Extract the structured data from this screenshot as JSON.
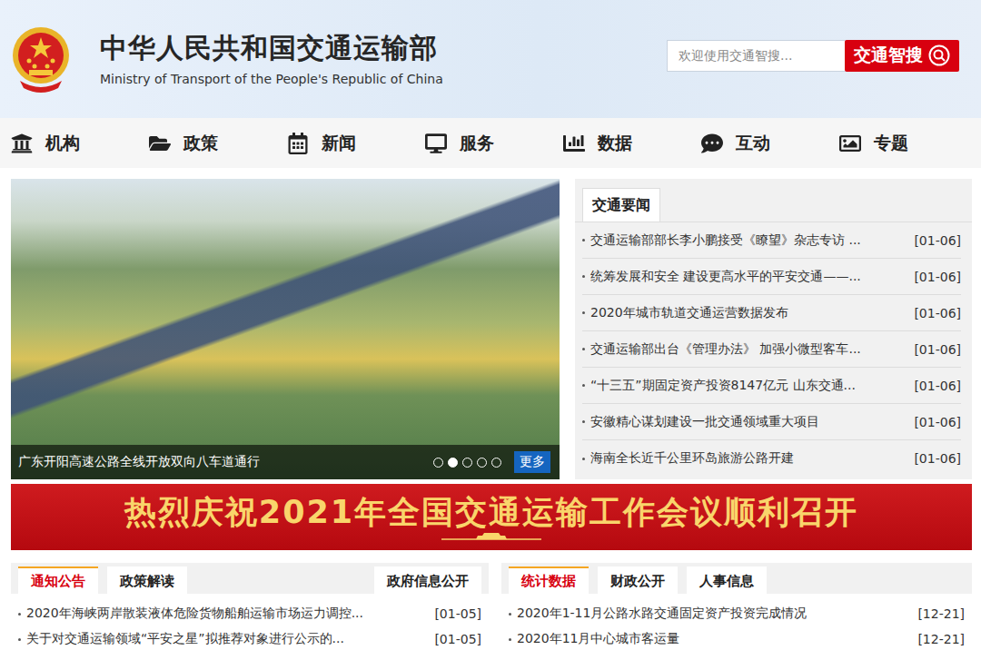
{
  "header": {
    "title": "中华人民共和国交通运输部",
    "subtitle": "Ministry of Transport of the People's Republic of China",
    "search": {
      "placeholder": "欢迎使用交通智搜...",
      "button": "交通智搜"
    }
  },
  "nav": [
    {
      "label": "机构"
    },
    {
      "label": "政策"
    },
    {
      "label": "新闻"
    },
    {
      "label": "服务"
    },
    {
      "label": "数据"
    },
    {
      "label": "互动"
    },
    {
      "label": "专题"
    }
  ],
  "carousel": {
    "caption": "广东开阳高速公路全线开放双向八车道通行",
    "slides": [
      {
        "selected": false
      },
      {
        "selected": true
      },
      {
        "selected": false
      },
      {
        "selected": false
      },
      {
        "selected": false
      }
    ],
    "more": "更多"
  },
  "news": {
    "title": "交通要闻",
    "items": [
      {
        "text": "交通运输部部长李小鹏接受《瞭望》杂志专访 ...",
        "date": "[01-06]"
      },
      {
        "text": "统筹发展和安全 建设更高水平的平安交通——...",
        "date": "[01-06]"
      },
      {
        "text": "2020年城市轨道交通运营数据发布",
        "date": "[01-06]"
      },
      {
        "text": "交通运输部出台《管理办法》 加强小微型客车...",
        "date": "[01-06]"
      },
      {
        "text": "“十三五”期固定资产投资8147亿元 山东交通...",
        "date": "[01-06]"
      },
      {
        "text": "安徽精心谋划建设一批交通领域重大项目",
        "date": "[01-06]"
      },
      {
        "text": "海南全长近千公里环岛旅游公路开建",
        "date": "[01-06]"
      }
    ]
  },
  "banner": "热烈庆祝2021年全国交通运输工作会议顺利召开",
  "panels": [
    {
      "tabs": [
        {
          "label": "通知公告",
          "selected": true
        },
        {
          "label": "政策解读",
          "selected": false
        }
      ],
      "link": "政府信息公开",
      "items": [
        {
          "text": "2020年海峡两岸散装液体危险货物船舶运输市场运力调控...",
          "date": "[01-05]"
        },
        {
          "text": "关于对交通运输领域“平安之星”拟推荐对象进行公示的...",
          "date": "[01-05]"
        }
      ]
    },
    {
      "tabs": [
        {
          "label": "统计数据",
          "selected": true
        },
        {
          "label": "财政公开",
          "selected": false
        },
        {
          "label": "人事信息",
          "selected": false
        }
      ],
      "link": "",
      "items": [
        {
          "text": "2020年1-11月公路水路交通固定资产投资完成情况",
          "date": "[12-21]"
        },
        {
          "text": "2020年11月中心城市客运量",
          "date": "[12-21]"
        }
      ]
    }
  ]
}
